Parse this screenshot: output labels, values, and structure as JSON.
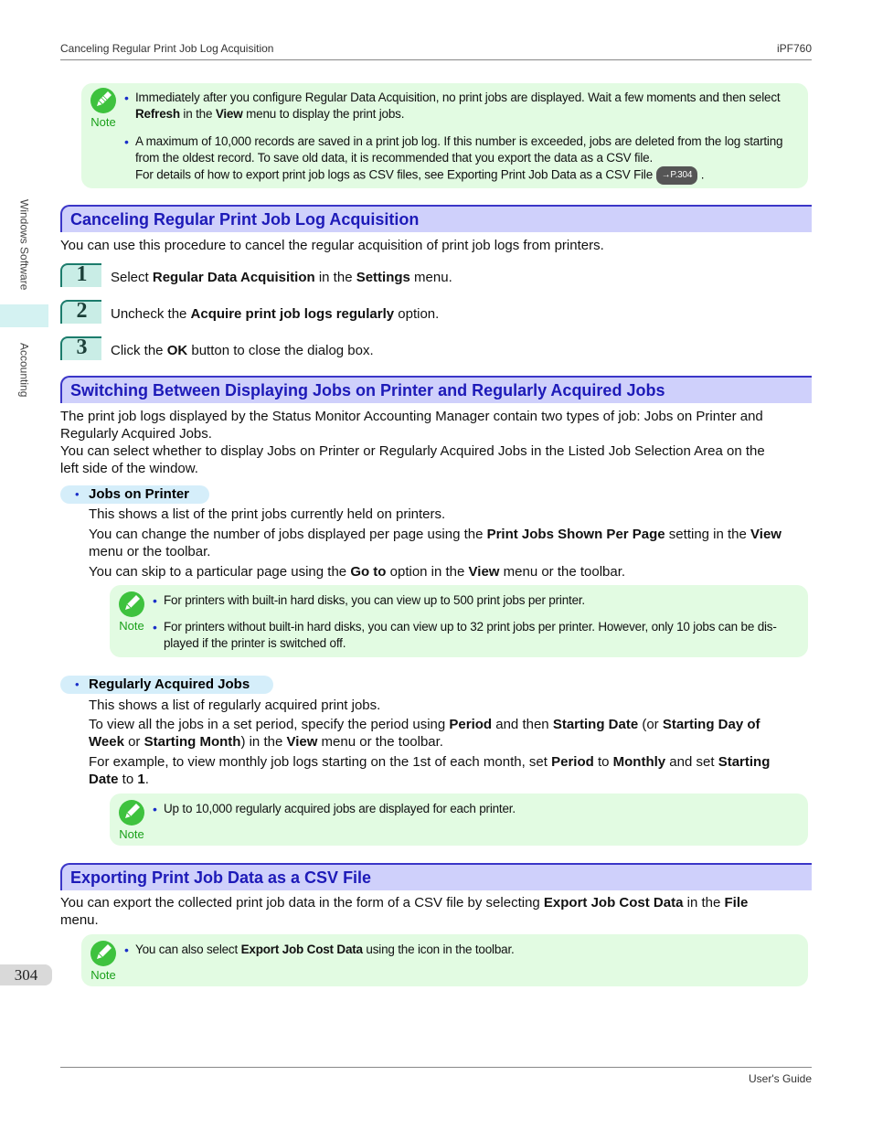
{
  "header": {
    "section_title": "Canceling Regular Print Job Log Acquisition",
    "model": "iPF760"
  },
  "side_tabs": [
    {
      "label": "Windows Software",
      "active": false
    },
    {
      "label": "Accounting",
      "active": true
    }
  ],
  "page_number": "304",
  "footer": {
    "right": "User's Guide"
  },
  "note_label": "Note",
  "note1": {
    "item1": {
      "a": "Immediately after you configure Regular Data Acquisition, no print jobs are displayed. Wait a few moments and then select",
      "b1": "Refresh",
      "c": " in the ",
      "b2": "View",
      "d": " menu to display the print jobs."
    },
    "item2": {
      "line1": "A maximum of 10,000 records are saved in a print job log. If this number is exceeded, jobs are deleted from the log starting",
      "line2": "from the oldest record. To save old data, it is recommended that you export the data as a CSV file.",
      "line3": "For details of how to export print job logs as CSV files, see Exporting Print Job Data as a CSV File",
      "ref": "→P.304",
      "end": " ."
    }
  },
  "section1": {
    "title": "Canceling Regular Print Job Log Acquisition",
    "intro": "You can use this procedure to cancel the regular acquisition of print job logs from printers.",
    "steps": [
      {
        "num": "1",
        "a": "Select ",
        "b1": "Regular Data Acquisition",
        "c": " in the ",
        "b2": "Settings",
        "d": " menu."
      },
      {
        "num": "2",
        "a": "Uncheck the ",
        "b1": "Acquire print job logs regularly",
        "c": " option."
      },
      {
        "num": "3",
        "a": "Click the ",
        "b1": "OK",
        "c": " button to close the dialog box."
      }
    ]
  },
  "section2": {
    "title": "Switching Between Displaying Jobs on Printer and Regularly Acquired Jobs",
    "p1": "The print job logs displayed by the Status Monitor Accounting Manager contain two types of job: Jobs on Printer and",
    "p1b": "Regularly Acquired Jobs.",
    "p2": "You can select whether to display Jobs on Printer or Regularly Acquired Jobs in the Listed Job Selection Area on the",
    "p2b": "left side of the window.",
    "sub1": {
      "title": "Jobs on Printer",
      "l1": "This shows a list of the print jobs currently held on printers.",
      "l2a": "You can change the number of jobs displayed per page using the ",
      "l2b": "Print Jobs Shown Per Page",
      "l2c": " setting in the ",
      "l2d": "View",
      "l2e": "menu or the toolbar.",
      "l3a": "You can skip to a particular page using the ",
      "l3b": "Go to",
      "l3c": " option in the ",
      "l3d": "View",
      "l3e": " menu or the toolbar.",
      "note_items": [
        "For printers with built-in hard disks, you can view up to 500 print jobs per printer.",
        "For printers without built-in hard disks, you can view up to 32 print jobs per printer. However, only 10 jobs can be dis-",
        "played if the printer is switched off."
      ]
    },
    "sub2": {
      "title": "Regularly Acquired Jobs",
      "l1": "This shows a list of regularly acquired print jobs.",
      "l2a": "To view all the jobs in a set period, specify the period using ",
      "l2b": "Period",
      "l2c": " and then ",
      "l2d": "Starting Date",
      "l2e": " (or ",
      "l2f": "Starting Day of",
      "l3a": "Week",
      "l3b": " or ",
      "l3c": "Starting Month",
      "l3d": ") in the ",
      "l3e": "View",
      "l3f": " menu or the toolbar.",
      "l4a": "For example, to view monthly job logs starting on the 1st of each month, set ",
      "l4b": "Period",
      "l4c": " to ",
      "l4d": "Monthly",
      "l4e": " and set ",
      "l4f": "Starting",
      "l5a": "Date",
      "l5b": " to ",
      "l5c": "1",
      "l5d": ".",
      "note_item": "Up to 10,000 regularly acquired jobs are displayed for each printer."
    }
  },
  "section3": {
    "title": "Exporting Print Job Data as a CSV File",
    "p1a": "You can export the collected print job data in the form of a CSV file by selecting ",
    "p1b": "Export Job Cost Data",
    "p1c": " in the ",
    "p1d": "File",
    "p1e": "menu.",
    "note_a": "You can also select ",
    "note_b": "Export Job Cost Data",
    "note_c": " using the icon in the toolbar."
  }
}
